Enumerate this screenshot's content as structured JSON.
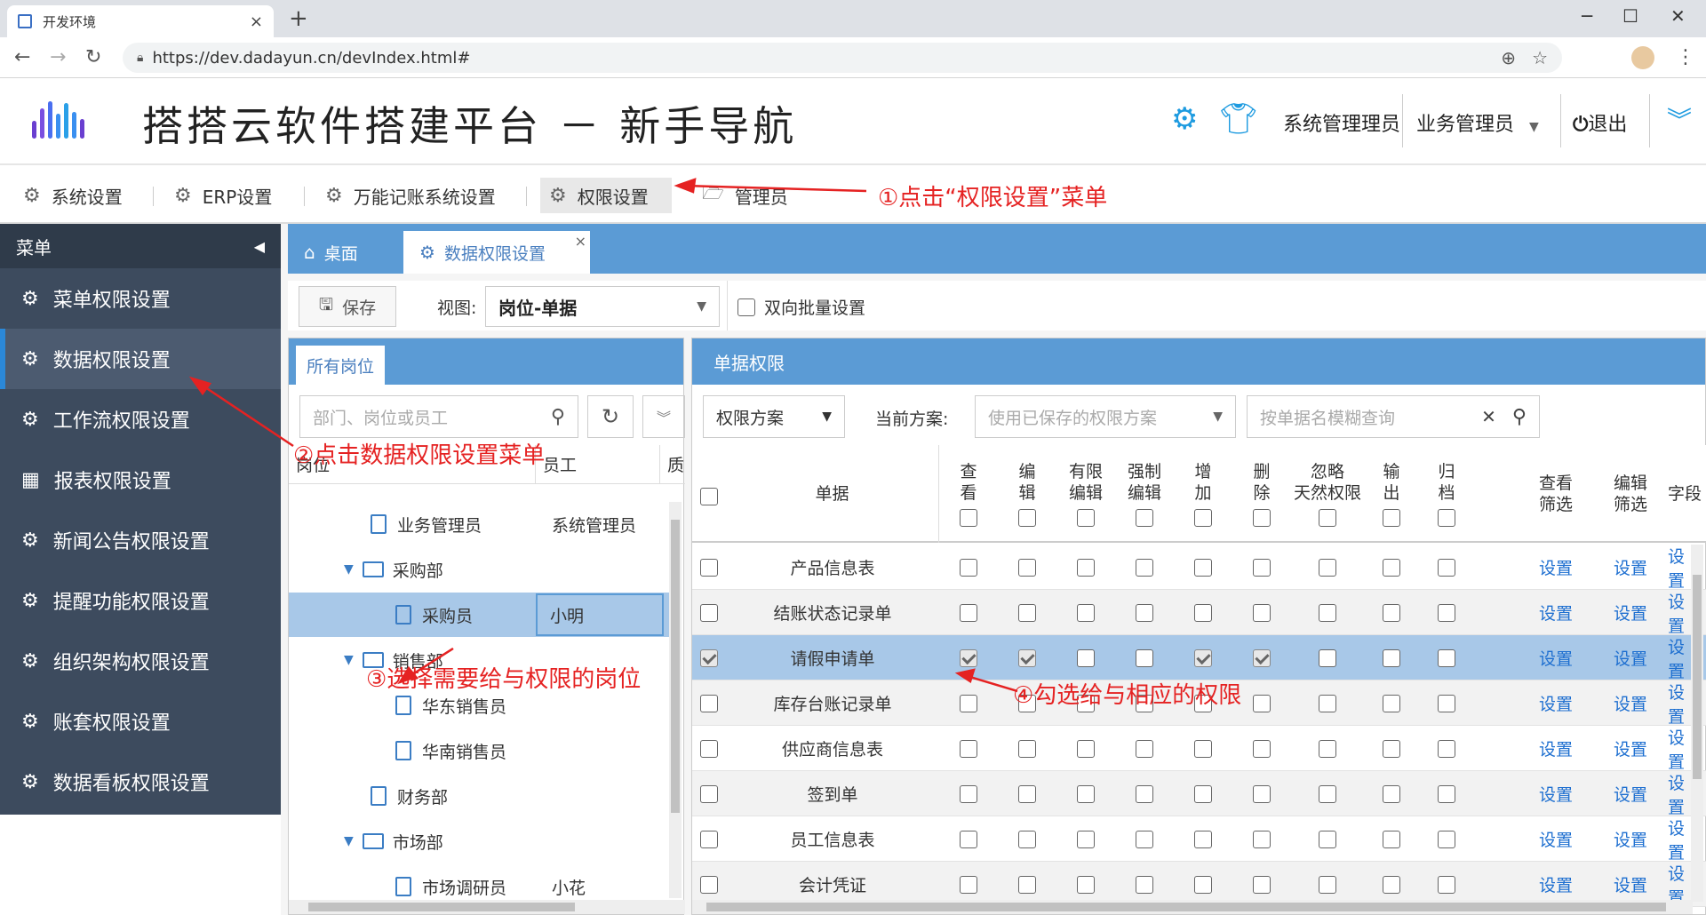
{
  "browser": {
    "tab_title": "开发环境",
    "tab_close": "×",
    "new_tab": "+",
    "url": "https://dev.dadayun.cn/devIndex.html#",
    "win_min": "─",
    "win_max": "☐",
    "win_close": "✕"
  },
  "header": {
    "title": "搭搭云软件搭建平台 － 新手导航",
    "user1": "系统管理理员",
    "user2": "业务管理员",
    "logout": "退出"
  },
  "menubar": {
    "items": [
      "系统设置",
      "ERP设置",
      "万能记账系统设置",
      "权限设置",
      "管理员"
    ]
  },
  "annotations": {
    "a1": "①点击“权限设置”菜单",
    "a2": "②点击数据权限设置菜单",
    "a3": "③选择需要给与权限的岗位",
    "a4": "④勾选给与相应的权限"
  },
  "sidebar": {
    "title": "菜单",
    "items": [
      "菜单权限设置",
      "数据权限设置",
      "工作流权限设置",
      "报表权限设置",
      "新闻公告权限设置",
      "提醒功能权限设置",
      "组织架构权限设置",
      "账套权限设置",
      "数据看板权限设置"
    ]
  },
  "tabs": {
    "home": "桌面",
    "current": "数据权限设置",
    "close": "×"
  },
  "toolbar": {
    "save": "保存",
    "view_label": "视图:",
    "view_value": "岗位-单据",
    "bidirectional": "双向批量设置"
  },
  "left": {
    "tab": "所有岗位",
    "search_placeholder": "部门、岗位或员工",
    "col_post": "岗位",
    "col_emp": "员工",
    "col_more": "质",
    "rows": [
      {
        "post": "业务管理员",
        "emp": "系统管理员",
        "type": "doc",
        "indent": 1
      },
      {
        "post": "采购部",
        "emp": "",
        "type": "folder",
        "indent": 0
      },
      {
        "post": "采购员",
        "emp": "小明",
        "type": "doc",
        "indent": 2,
        "selected": true
      },
      {
        "post": "销售部",
        "emp": "",
        "type": "folder",
        "indent": 0
      },
      {
        "post": "华东销售员",
        "emp": "",
        "type": "doc",
        "indent": 2
      },
      {
        "post": "华南销售员",
        "emp": "",
        "type": "doc",
        "indent": 2
      },
      {
        "post": "财务部",
        "emp": "",
        "type": "doc",
        "indent": 1
      },
      {
        "post": "市场部",
        "emp": "",
        "type": "folder",
        "indent": 0
      },
      {
        "post": "市场调研员",
        "emp": "小花",
        "type": "doc",
        "indent": 2
      }
    ]
  },
  "right": {
    "title": "单据权限",
    "scheme_btn": "权限方案",
    "current_label": "当前方案:",
    "scheme_placeholder": "使用已保存的权限方案",
    "query_placeholder": "按单据名模糊查询",
    "clear": "✕",
    "columns": [
      {
        "l1": "查",
        "l2": "看"
      },
      {
        "l1": "编",
        "l2": "辑"
      },
      {
        "l1": "有限",
        "l2": "编辑"
      },
      {
        "l1": "强制",
        "l2": "编辑"
      },
      {
        "l1": "增",
        "l2": "加"
      },
      {
        "l1": "删",
        "l2": "除"
      },
      {
        "l1": "忽略",
        "l2": "天然权限"
      },
      {
        "l1": "输",
        "l2": "出"
      },
      {
        "l1": "归",
        "l2": "档"
      }
    ],
    "col_doc": "单据",
    "col_view_filter": "查看\n筛选",
    "col_view_filter_l1": "查看",
    "col_view_filter_l2": "筛选",
    "col_edit_filter_l1": "编辑",
    "col_edit_filter_l2": "筛选",
    "col_field": "字段",
    "set": "设置",
    "rows": [
      {
        "name": "产品信息表",
        "checks": [
          0,
          0,
          0,
          0,
          0,
          0,
          0,
          0,
          0
        ]
      },
      {
        "name": "结账状态记录单",
        "checks": [
          0,
          0,
          0,
          0,
          0,
          0,
          0,
          0,
          0
        ]
      },
      {
        "name": "请假申请单",
        "checks": [
          1,
          1,
          0,
          0,
          1,
          1,
          0,
          0,
          0
        ],
        "highlight": true
      },
      {
        "name": "库存台账记录单",
        "checks": [
          0,
          0,
          0,
          0,
          0,
          0,
          0,
          0,
          0
        ]
      },
      {
        "name": "供应商信息表",
        "checks": [
          0,
          0,
          0,
          0,
          0,
          0,
          0,
          0,
          0
        ]
      },
      {
        "name": "签到单",
        "checks": [
          0,
          0,
          0,
          0,
          0,
          0,
          0,
          0,
          0
        ]
      },
      {
        "name": "员工信息表",
        "checks": [
          0,
          0,
          0,
          0,
          0,
          0,
          0,
          0,
          0
        ]
      },
      {
        "name": "会计凭证",
        "checks": [
          0,
          0,
          0,
          0,
          0,
          0,
          0,
          0,
          0
        ]
      }
    ]
  }
}
